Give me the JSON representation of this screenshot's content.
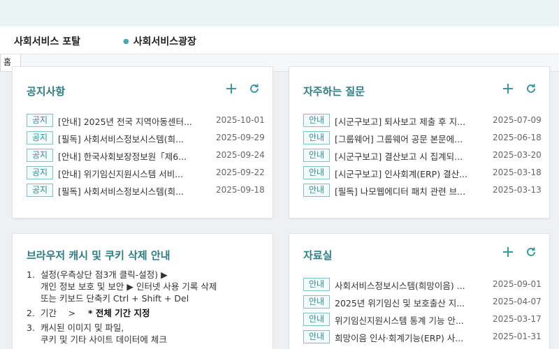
{
  "header": {
    "portal_title": "사회서비스 포탈",
    "nav_item": "사회서비스광장"
  },
  "tabs": {
    "home": "홈"
  },
  "notice": {
    "title": "공지사항",
    "items": [
      {
        "badge": "공지",
        "title": "[안내] 2025년 전국 지역아동센터...",
        "date": "2025-10-01"
      },
      {
        "badge": "공지",
        "title": "[필독] 사회서비스정보시스템(희...",
        "date": "2025-09-29"
      },
      {
        "badge": "공지",
        "title": "[안내] 한국사회보장정보원「제6...",
        "date": "2025-09-24"
      },
      {
        "badge": "공지",
        "title": "[안내] 위기임신지원시스템 서비...",
        "date": "2025-09-22"
      },
      {
        "badge": "공지",
        "title": "[필독] 사회서비스정보시스템(희...",
        "date": "2025-09-18"
      }
    ]
  },
  "faq": {
    "title": "자주하는 질문",
    "items": [
      {
        "badge": "안내",
        "title": "[시군구보고] 퇴사보고 제출 후 지...",
        "date": "2025-07-09"
      },
      {
        "badge": "안내",
        "title": "[그룹웨어] 그룹웨어 공문 본문에...",
        "date": "2025-06-18"
      },
      {
        "badge": "안내",
        "title": "[시군구보고] 결산보고 시 집계되...",
        "date": "2025-03-20"
      },
      {
        "badge": "안내",
        "title": "[시군구보고] 인사회계(ERP) 결산...",
        "date": "2025-03-18"
      },
      {
        "badge": "안내",
        "title": "[필독] 나모웹에디터 패치 관련 브...",
        "date": "2025-03-13"
      }
    ]
  },
  "cache_guide": {
    "title": "브라우저 캐시 및 쿠키 삭제 안내",
    "step1_num": "1.",
    "step1_line1": "설정(우측상단 점3개 클릭-설정) ▶",
    "step1_line2": "개인 정보 보호 및 보안 ▶ 인터넷 사용 기록 삭제",
    "step1_line3": "또는 키보드 단축키 Ctrl + Shift + Del",
    "step2_num": "2.",
    "step2_text": "기간　 >",
    "step2_bold": "* 전체 기간 지정",
    "step3_num": "3.",
    "step3_line1": "캐시된 이미지 및 파일,",
    "step3_line2": "쿠키 및 기타 사이트 데이터에 체크"
  },
  "resources": {
    "title": "자료실",
    "items": [
      {
        "badge": "안내",
        "title": "사회서비스정보시스템(희망이음) ...",
        "date": "2025-09-01"
      },
      {
        "badge": "안내",
        "title": "2025년 위기임신 및 보호출산 지...",
        "date": "2025-04-07"
      },
      {
        "badge": "안내",
        "title": "위기임신지원시스템 통계 기능 안...",
        "date": "2025-03-17"
      },
      {
        "badge": "안내",
        "title": "희망이음 인사·회계기능(ERP) 사...",
        "date": "2025-01-31"
      }
    ]
  },
  "icons": {
    "add": "plus-icon",
    "refresh": "refresh-icon"
  },
  "colors": {
    "accent": "#2e7d84",
    "badge_border": "#7cc3c8",
    "header_strip": "#eaf4f4"
  }
}
